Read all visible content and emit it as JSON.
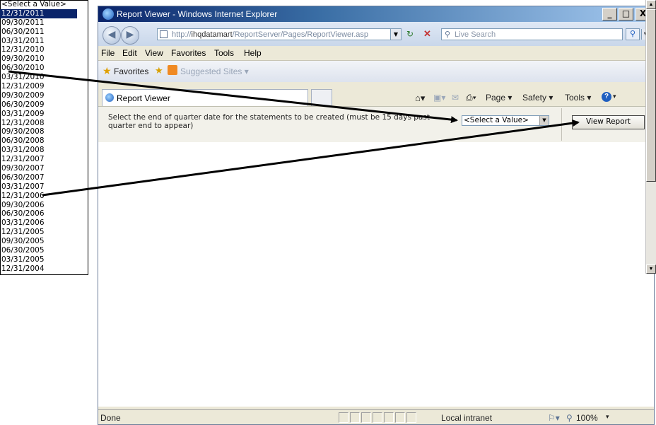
{
  "window": {
    "title": "Report Viewer - Windows Internet Explorer",
    "minimize_label": "_",
    "maximize_label": "□",
    "close_label": "X"
  },
  "address": {
    "url_prefix": "http://",
    "url_host": "ihqdatamart",
    "url_path": "/ReportServer/Pages/ReportViewer.asp",
    "search_placeholder": "Live Search"
  },
  "menu": [
    "File",
    "Edit",
    "View",
    "Favorites",
    "Tools",
    "Help"
  ],
  "favorites_bar": {
    "favorites_label": "Favorites",
    "suggested_label": "Suggested Sites ▾"
  },
  "tab": {
    "title": "Report Viewer"
  },
  "command_bar": {
    "page_label": "Page ▾",
    "safety_label": "Safety ▾",
    "tools_label": "Tools ▾"
  },
  "parameters": {
    "label": "Select the end of quarter date for the statements to be created (must be 15 days past quarter end to appear)",
    "select_value": "<Select a Value>",
    "view_report_label": "View Report"
  },
  "dropdown": {
    "options": [
      "<Select a Value>",
      "12/31/2011",
      "09/30/2011",
      "06/30/2011",
      "03/31/2011",
      "12/31/2010",
      "09/30/2010",
      "06/30/2010",
      "03/31/2010",
      "12/31/2009",
      "09/30/2009",
      "06/30/2009",
      "03/31/2009",
      "12/31/2008",
      "09/30/2008",
      "06/30/2008",
      "03/31/2008",
      "12/31/2007",
      "09/30/2007",
      "06/30/2007",
      "03/31/2007",
      "12/31/2006",
      "09/30/2006",
      "06/30/2006",
      "03/31/2006",
      "12/31/2005",
      "09/30/2005",
      "06/30/2005",
      "03/31/2005",
      "12/31/2004"
    ],
    "highlighted_index": 1
  },
  "status": {
    "left_text": "Done",
    "zone_text": "Local intranet",
    "zoom_text": "100%"
  },
  "colors": {
    "annotation_arrow": "#000000",
    "selection": "#0a246a"
  }
}
